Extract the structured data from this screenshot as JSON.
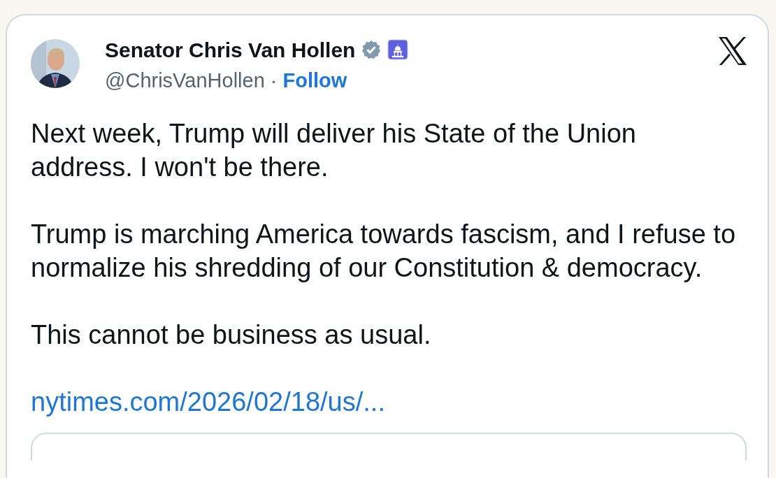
{
  "author": {
    "name": "Senator Chris Van Hollen",
    "handle": "@ChrisVanHollen",
    "separator": "·",
    "follow": "Follow"
  },
  "body": [
    "Next week, Trump will deliver his State of the Union address. I won't be there.",
    "Trump is marching America towards fascism, and I refuse to normalize his shredding of our Constitution & democracy.",
    "This cannot be business as usual."
  ],
  "link": "nytimes.com/2026/02/18/us/..."
}
